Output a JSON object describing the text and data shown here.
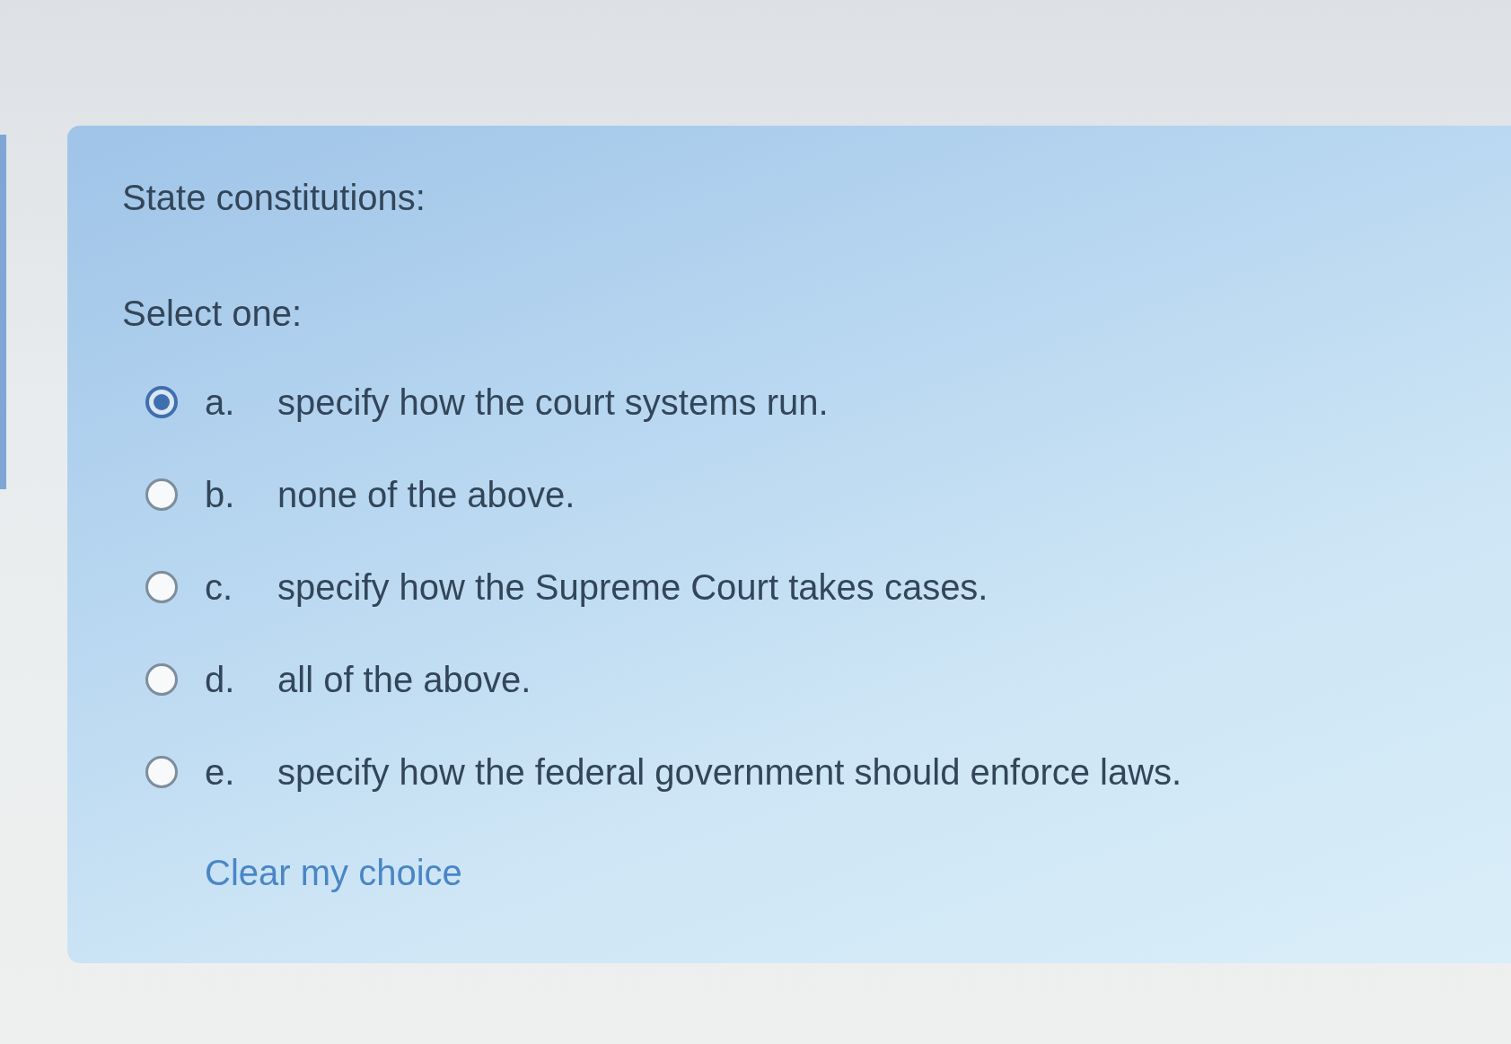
{
  "question": {
    "prompt": "State constitutions:",
    "instruction": "Select one:"
  },
  "options": [
    {
      "letter": "a.",
      "text": "specify how the court systems run.",
      "selected": true
    },
    {
      "letter": "b.",
      "text": "none of the above.",
      "selected": false
    },
    {
      "letter": "c.",
      "text": "specify how the Supreme Court takes cases.",
      "selected": false
    },
    {
      "letter": "d.",
      "text": "all of the above.",
      "selected": false
    },
    {
      "letter": "e.",
      "text": "specify how the federal government should enforce laws.",
      "selected": false
    }
  ],
  "clear_link": "Clear my choice"
}
